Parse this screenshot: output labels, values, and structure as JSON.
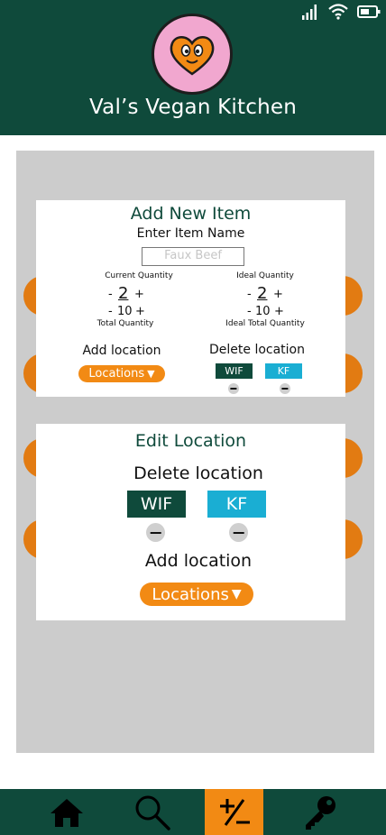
{
  "app": {
    "title": "Val’s Vegan Kitchen",
    "logo_text": "VAL'S VEGAN KITCHEN"
  },
  "status_bar": {
    "icons": [
      "signal-icon",
      "wifi-icon",
      "battery-icon"
    ]
  },
  "add_item": {
    "heading": "Add New Item",
    "name_label": "Enter Item Name",
    "name_placeholder": "Faux Beef",
    "current_quantity": {
      "label": "Current Quantity",
      "minus": "-",
      "plus": "+",
      "value": "2"
    },
    "total_quantity": {
      "label": "Total Quantity",
      "minus": "-",
      "plus": "+",
      "value": "10"
    },
    "ideal_quantity": {
      "label": "Ideal Quantity",
      "minus": "-",
      "plus": "+",
      "value": "2"
    },
    "ideal_total_quantity": {
      "label": "Ideal Total Quantity",
      "minus": "-",
      "plus": "+",
      "value": "10"
    },
    "add_location_label": "Add location",
    "locations_dropdown": "Locations",
    "delete_location_label": "Delete location",
    "tags": [
      "WIF",
      "KF"
    ]
  },
  "edit_location": {
    "heading": "Edit Location",
    "delete_location_label": "Delete location",
    "tags": [
      "WIF",
      "KF"
    ],
    "add_location_label": "Add location",
    "locations_dropdown": "Locations"
  },
  "nav": {
    "items": [
      {
        "icon": "home-icon",
        "active": false
      },
      {
        "icon": "search-icon",
        "active": false
      },
      {
        "icon": "plus-minus-icon",
        "active": true
      },
      {
        "icon": "key-icon",
        "active": false
      }
    ]
  },
  "colors": {
    "primary": "#0f4a3b",
    "accent": "#f28a14",
    "kf": "#1aaed3",
    "background": "#cccccc"
  }
}
